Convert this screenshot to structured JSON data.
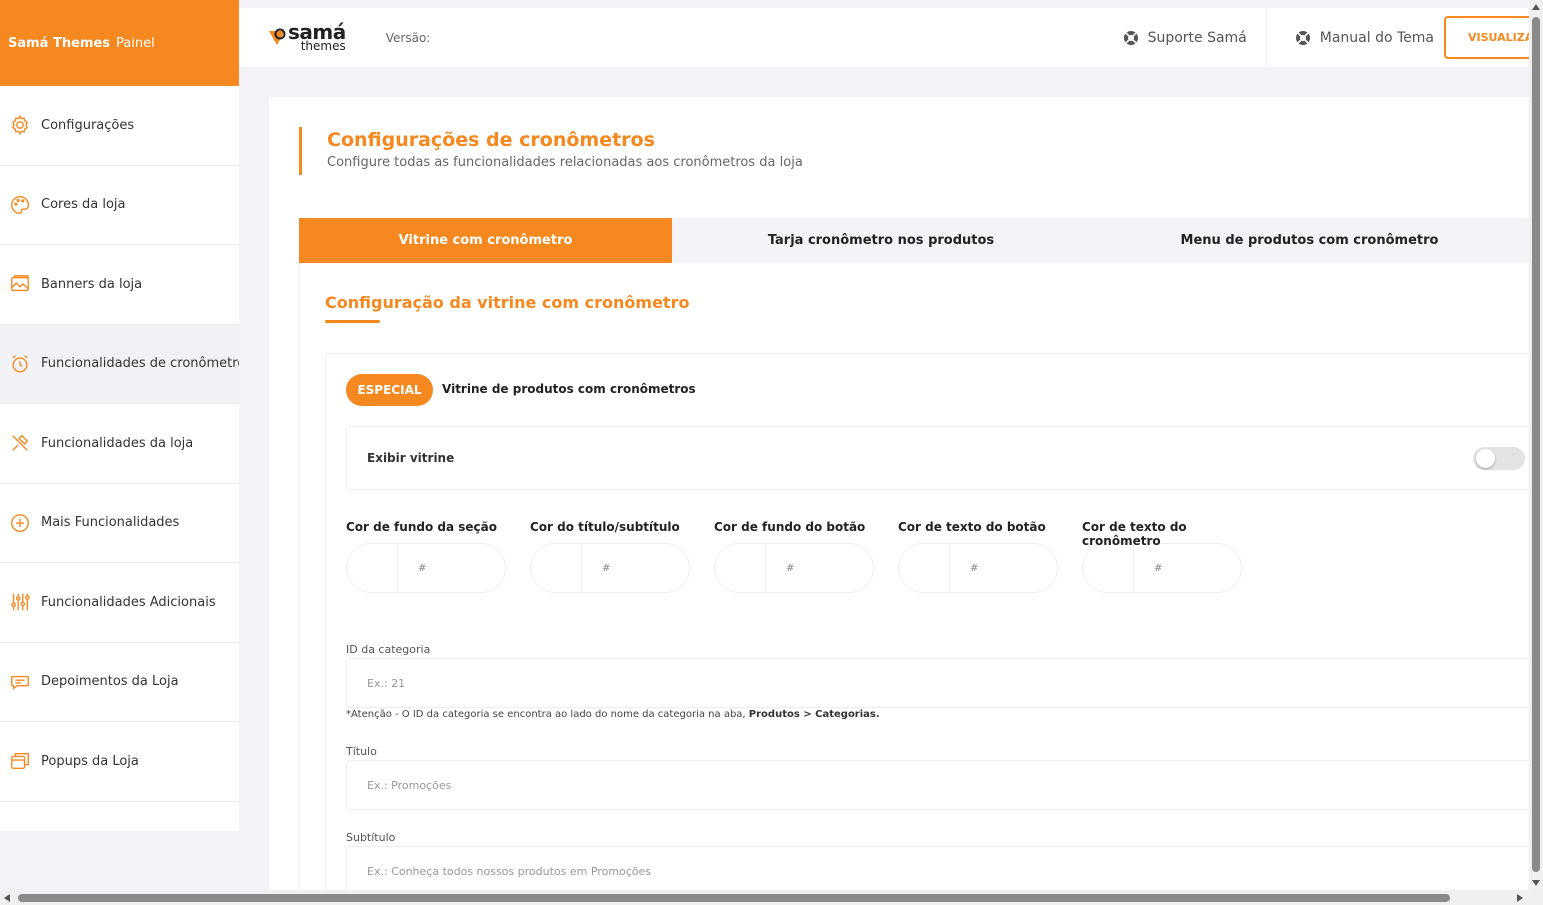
{
  "brand": {
    "name": "Samá Themes",
    "suffix": "Painel"
  },
  "sidebar": {
    "items": [
      {
        "label": "Configurações",
        "icon": "gear-icon"
      },
      {
        "label": "Cores da loja",
        "icon": "palette-icon"
      },
      {
        "label": "Banners da loja",
        "icon": "image-icon"
      },
      {
        "label": "Funcionalidades de cronômetros",
        "icon": "alarm-clock-icon",
        "active": true
      },
      {
        "label": "Funcionalidades da loja",
        "icon": "tools-icon"
      },
      {
        "label": "Mais Funcionalidades",
        "icon": "plus-circle-icon"
      },
      {
        "label": "Funcionalidades Adicionais",
        "icon": "sliders-icon"
      },
      {
        "label": "Depoimentos da Loja",
        "icon": "chat-bubble-icon"
      },
      {
        "label": "Popups da Loja",
        "icon": "popup-window-icon"
      }
    ]
  },
  "header": {
    "logo": {
      "line1": "samá",
      "line2": "themes"
    },
    "version_label": "Versão:",
    "support_link": "Suporte Samá",
    "manual_link": "Manual do Tema",
    "preview_button": "VISUALIZAR"
  },
  "page": {
    "title": "Configurações de cronômetros",
    "subtitle": "Configure todas as funcionalidades relacionadas aos cronômetros da loja"
  },
  "tabs": [
    {
      "label": "Vitrine com cronômetro",
      "active": true
    },
    {
      "label": "Tarja cronômetro nos produtos"
    },
    {
      "label": "Menu de produtos com cronômetro"
    }
  ],
  "section": {
    "title": "Configuração da vitrine com cronômetro",
    "badge": "ESPECIAL",
    "badge_text": "Vitrine de produtos com cronômetros",
    "toggle_label": "Exibir vitrine",
    "toggle_on": false
  },
  "colors": [
    {
      "label": "Cor de fundo da seção",
      "placeholder": "#"
    },
    {
      "label": "Cor do título/subtítulo",
      "placeholder": "#"
    },
    {
      "label": "Cor de fundo do botão",
      "placeholder": "#"
    },
    {
      "label": "Cor de texto do botão",
      "placeholder": "#"
    },
    {
      "label": "Cor de texto do cronômetro",
      "placeholder": "#"
    }
  ],
  "fields": {
    "category_label": "ID da categoria",
    "category_placeholder": "Ex.: 21",
    "hint_text": "*Atenção - O ID da categoria se encontra ao lado do nome da categoria na aba, ",
    "hint_bold": "Produtos > Categorias.",
    "title_label": "Título",
    "title_placeholder": "Ex.: Promoções",
    "subtitle_label": "Subtítulo",
    "subtitle_placeholder": "Ex.: Conheça todos nossos produtos em Promoções"
  },
  "theme": {
    "accent": "#f5881f"
  }
}
